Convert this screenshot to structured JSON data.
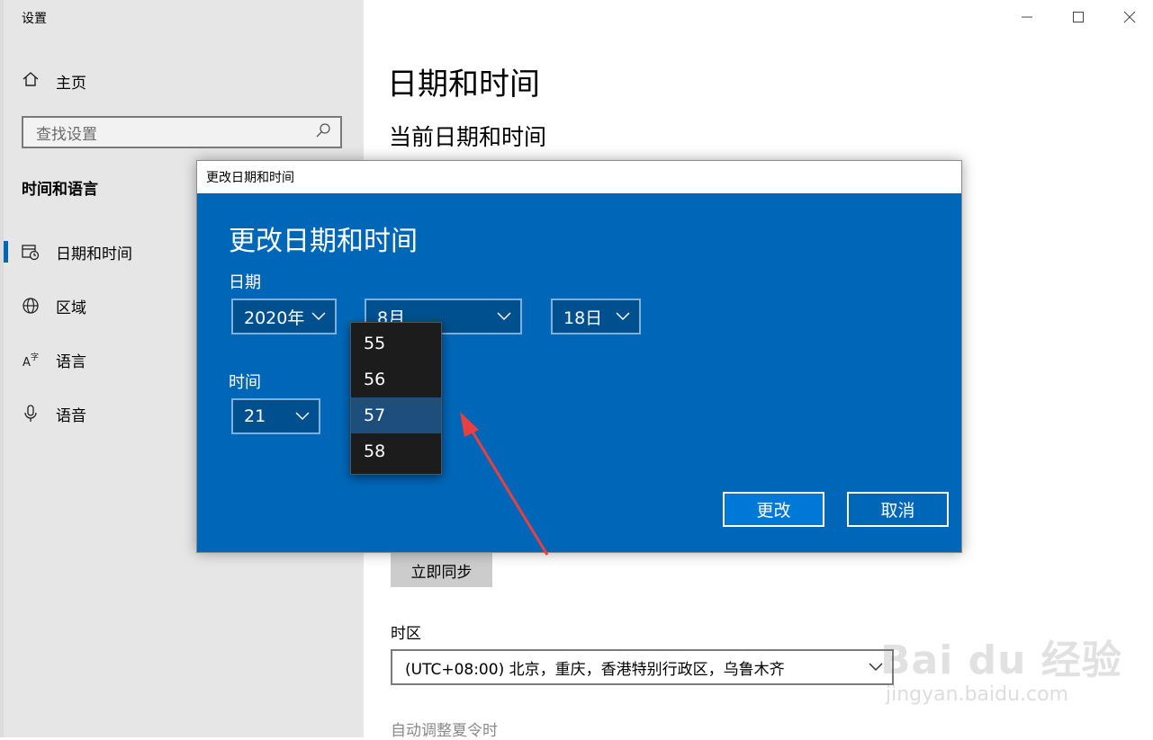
{
  "window": {
    "title": "设置"
  },
  "sidebar": {
    "home_label": "主页",
    "search_placeholder": "查找设置",
    "section_title": "时间和语言",
    "items": [
      {
        "label": "日期和时间",
        "icon": "calendar-clock-icon",
        "active": true
      },
      {
        "label": "区域",
        "icon": "globe-icon",
        "active": false
      },
      {
        "label": "语言",
        "icon": "language-icon",
        "active": false
      },
      {
        "label": "语音",
        "icon": "microphone-icon",
        "active": false
      }
    ]
  },
  "main": {
    "title": "日期和时间",
    "subtitle": "当前日期和时间",
    "sync_button": "立即同步",
    "timezone_label": "时区",
    "timezone_value": "(UTC+08:00) 北京，重庆，香港特别行政区，乌鲁木齐",
    "dst_label": "自动调整夏令时"
  },
  "dialog": {
    "window_title": "更改日期和时间",
    "heading": "更改日期和时间",
    "date_label": "日期",
    "year": "2020年",
    "month": "8月",
    "day": "18日",
    "time_label": "时间",
    "hour": "21",
    "minute_options": [
      "55",
      "56",
      "57",
      "58"
    ],
    "minute_selected": "57",
    "change_button": "更改",
    "cancel_button": "取消"
  },
  "colors": {
    "accent": "#0067b8",
    "dialog_bg": "#0067b8",
    "arrow": "#e84040"
  },
  "watermark": {
    "logo": "Bai du 经验",
    "url": "jingyan.baidu.com"
  }
}
